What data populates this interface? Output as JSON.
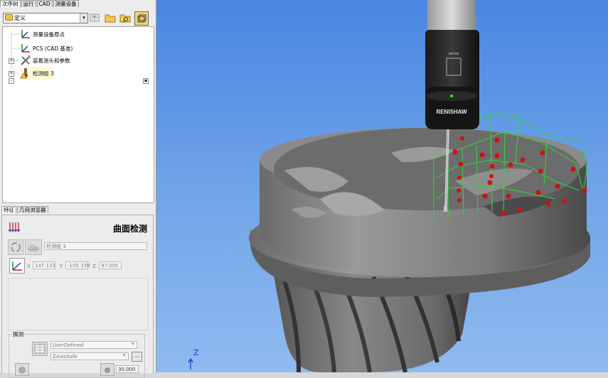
{
  "tabs": [
    "次序树",
    "运行",
    "CAD",
    "测量设备"
  ],
  "toolbar": {
    "combo_value": "定义",
    "buttons": [
      "up-icon",
      "folder-icon",
      "search-folder-icon",
      "layer-icon"
    ]
  },
  "tree": {
    "items": [
      {
        "label": "测量设备原点",
        "icon": "coordinate-axes-icon"
      },
      {
        "label": "PCS (CAD 基准)",
        "icon": "coordinate-axes-icon"
      },
      {
        "label": "装着测头和参数",
        "icon": "tools-icon"
      },
      {
        "label": "检测组 3",
        "icon": "warning-probe-icon"
      }
    ]
  },
  "bottom_tabs": [
    "特征",
    "几何浏览器"
  ],
  "feature": {
    "title": "曲面检测",
    "name_value": "检测组 3",
    "x_label": "X",
    "x_value": "147.131",
    "y_label": "Y",
    "y_value": "-105.339",
    "z_label": "Z",
    "z_value": "97.000"
  },
  "probe": {
    "group_label": "探测",
    "mode_value": "UserDefined",
    "axis_value": "ZAxisSafe",
    "more_label": "...",
    "distance_value": "30.000"
  },
  "viewport": {
    "probe_brand": "RENISHAW",
    "probe_model": "MP700",
    "axis_label": "Z"
  },
  "colors": {
    "accent": "#f2d77a",
    "sky": "#5b95e6",
    "path": "#2bdb3a",
    "point": "#d01010"
  }
}
